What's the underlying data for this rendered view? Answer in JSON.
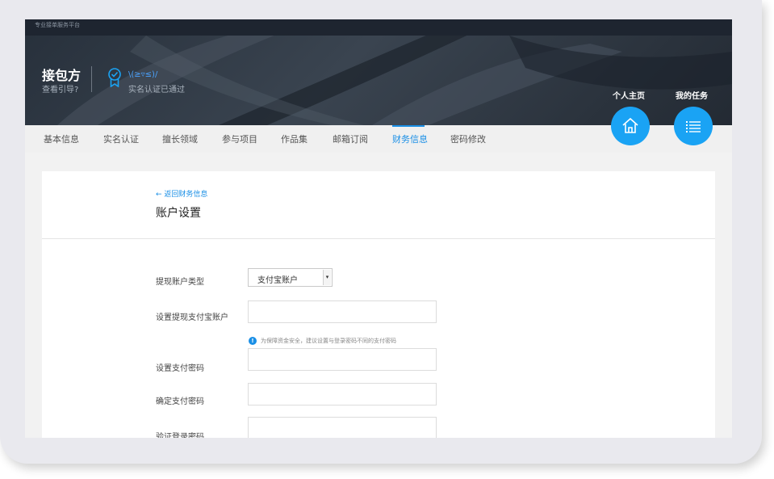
{
  "header": {
    "brand_text": "专业接单服务平台",
    "user_name": "接包方",
    "guide_link": "查看引导?",
    "nickname": "\\(≥▿≤)/",
    "verify_status": "实名认证已通过",
    "quick_links": [
      {
        "label": "个人主页",
        "icon": "home-icon"
      },
      {
        "label": "我的任务",
        "icon": "list-icon"
      }
    ]
  },
  "nav": {
    "tabs": [
      {
        "label": "基本信息",
        "active": false
      },
      {
        "label": "实名认证",
        "active": false
      },
      {
        "label": "擅长领域",
        "active": false
      },
      {
        "label": "参与项目",
        "active": false
      },
      {
        "label": "作品集",
        "active": false
      },
      {
        "label": "邮箱订阅",
        "active": false
      },
      {
        "label": "财务信息",
        "active": true
      },
      {
        "label": "密码修改",
        "active": false
      }
    ]
  },
  "content": {
    "back_link": "返回财务信息",
    "title": "账户设置",
    "fields": {
      "account_type_label": "提现账户类型",
      "account_type_value": "支付宝账户",
      "alipay_label": "设置提现支付宝账户",
      "hint": "为保障资金安全，建议设置与登录密码不同的支付密码",
      "pay_pwd_label": "设置支付密码",
      "confirm_pwd_label": "确定支付密码",
      "login_pwd_label": "验证登录密码"
    }
  },
  "colors": {
    "accent": "#1a8fe6",
    "circle_button": "#1aa3f4",
    "banner": "#2f3843"
  }
}
